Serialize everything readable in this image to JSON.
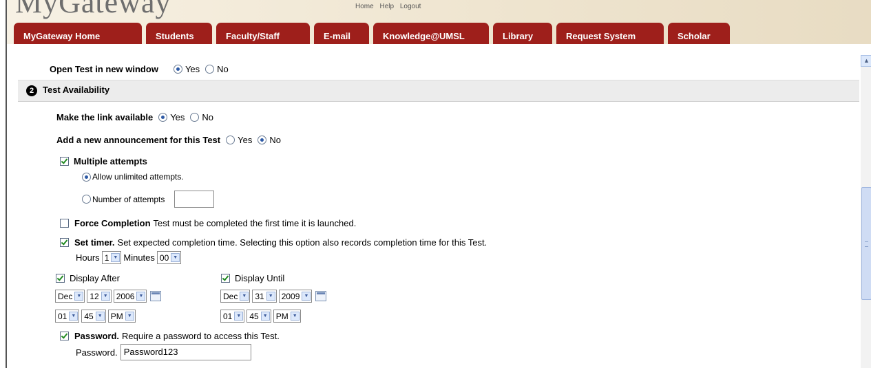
{
  "header": {
    "logo_text": "MyGateway",
    "toplinks": [
      "Home",
      "Help",
      "Logout"
    ],
    "tabs": [
      "MyGateway Home",
      "Students",
      "Faculty/Staff",
      "E-mail",
      "Knowledge@UMSL",
      "Library",
      "Request System",
      "Scholar"
    ]
  },
  "open_test": {
    "label": "Open Test in new window",
    "yes": "Yes",
    "no": "No",
    "selected": "Yes"
  },
  "section": {
    "number": "2",
    "title": "Test Availability"
  },
  "make_link": {
    "label": "Make the link available",
    "yes": "Yes",
    "no": "No",
    "selected": "Yes"
  },
  "announcement": {
    "label": "Add a new announcement for this Test",
    "yes": "Yes",
    "no": "No",
    "selected": "No"
  },
  "multiple_attempts": {
    "label": "Multiple attempts",
    "checked": true,
    "unlimited_label": "Allow unlimited attempts.",
    "number_label": "Number of attempts",
    "number_value": ""
  },
  "force_completion": {
    "label": "Force Completion",
    "desc": "Test must be completed the first time it is launched.",
    "checked": false
  },
  "set_timer": {
    "label": "Set timer.",
    "desc": "Set expected completion time. Selecting this option also records completion time for this Test.",
    "checked": true,
    "hours_label": "Hours",
    "hours_value": "1",
    "minutes_label": "Minutes",
    "minutes_value": "00"
  },
  "display_after": {
    "label": "Display After",
    "checked": true,
    "month": "Dec",
    "day": "12",
    "year": "2006",
    "hour": "01",
    "minute": "45",
    "ampm": "PM"
  },
  "display_until": {
    "label": "Display Until",
    "checked": true,
    "month": "Dec",
    "day": "31",
    "year": "2009",
    "hour": "01",
    "minute": "45",
    "ampm": "PM"
  },
  "password": {
    "label": "Password.",
    "desc": "Require a password to access this Test.",
    "checked": true,
    "field_label": "Password.",
    "value": "Password123"
  },
  "colors": {
    "tab_bg": "#9e1f1b",
    "section_bg": "#ececec",
    "check_green": "#1f8a20"
  },
  "icons": [
    "radio-icon",
    "checkbox-icon",
    "dropdown-arrow-icon",
    "calendar-icon",
    "scroll-up-icon"
  ]
}
